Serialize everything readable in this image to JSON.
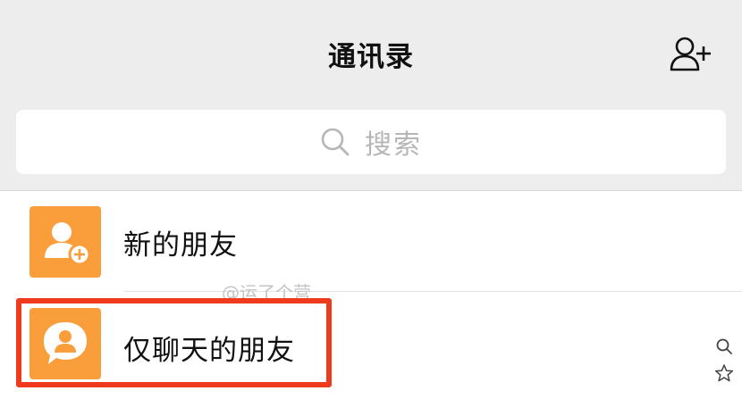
{
  "header": {
    "title": "通讯录",
    "add_contact_icon": "add-contact-icon"
  },
  "search": {
    "placeholder": "搜索",
    "icon": "search-icon"
  },
  "contacts_menu": [
    {
      "label": "新的朋友",
      "icon": "new-friend-icon",
      "color": "#fa9d3b"
    },
    {
      "label": "仅聊天的朋友",
      "icon": "chat-only-friend-icon",
      "color": "#fa9d3b"
    }
  ],
  "watermark": "@运了个营",
  "index_bar": {
    "search_icon": "index-search-icon",
    "star_icon": "index-star-icon"
  },
  "highlight_color": "#ef3a1d"
}
